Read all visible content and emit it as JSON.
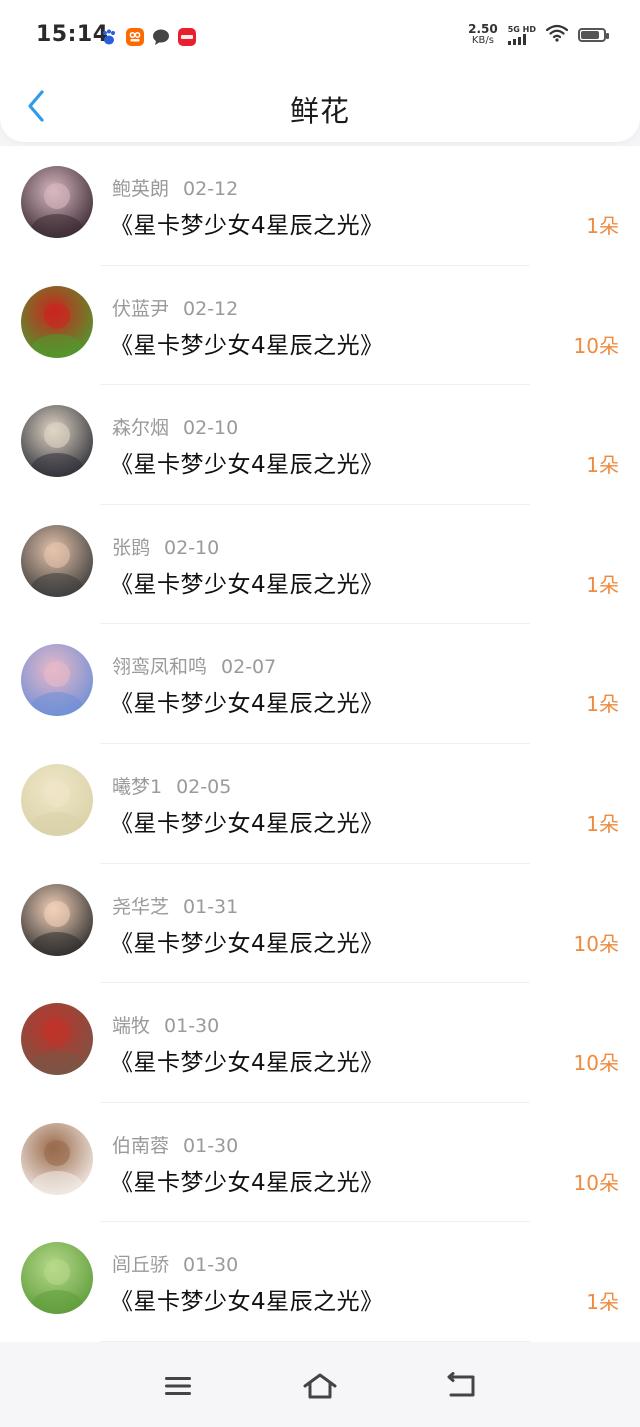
{
  "status_bar": {
    "time": "15:14",
    "net_speed": "2.50",
    "net_unit": "KB/s",
    "network": "5G HD",
    "battery_level": 0.8,
    "app_icons": [
      "baidu-paw-icon",
      "orange-app-icon",
      "chat-bubble-icon",
      "red-app-icon"
    ]
  },
  "header": {
    "title": "鲜花"
  },
  "colors": {
    "accent": "#2e9bea",
    "count": "#f08a3e",
    "meta": "#9a9a9a"
  },
  "records": [
    {
      "user": "鲍英朗",
      "date": "02-12",
      "book": "《星卡梦少女4星辰之光》",
      "count": "1朵",
      "avatar_colors": [
        "#3a2a32",
        "#d7b7c0"
      ]
    },
    {
      "user": "伏蓝尹",
      "date": "02-12",
      "book": "《星卡梦少女4星辰之光》",
      "count": "10朵",
      "avatar_colors": [
        "#4f9a2e",
        "#c9261f"
      ]
    },
    {
      "user": "森尔烟",
      "date": "02-10",
      "book": "《星卡梦少女4星辰之光》",
      "count": "1朵",
      "avatar_colors": [
        "#2f3038",
        "#e0d5c5"
      ]
    },
    {
      "user": "张鹍",
      "date": "02-10",
      "book": "《星卡梦少女4星辰之光》",
      "count": "1朵",
      "avatar_colors": [
        "#3c3c3c",
        "#e4c3ab"
      ]
    },
    {
      "user": "翎鸾凤和鸣",
      "date": "02-07",
      "book": "《星卡梦少女4星辰之光》",
      "count": "1朵",
      "avatar_colors": [
        "#6f8fd6",
        "#e8b9c8"
      ]
    },
    {
      "user": "曦梦1",
      "date": "02-05",
      "book": "《星卡梦少女4星辰之光》",
      "count": "1朵",
      "avatar_colors": [
        "#d9d2a8",
        "#f0e6c8"
      ]
    },
    {
      "user": "尧华芝",
      "date": "01-31",
      "book": "《星卡梦少女4星辰之光》",
      "count": "10朵",
      "avatar_colors": [
        "#2d2d2d",
        "#f2d0b8"
      ]
    },
    {
      "user": "端牧",
      "date": "01-30",
      "book": "《星卡梦少女4星辰之光》",
      "count": "10朵",
      "avatar_colors": [
        "#7a5546",
        "#c0332a"
      ]
    },
    {
      "user": "伯南蓉",
      "date": "01-30",
      "book": "《星卡梦少女4星辰之光》",
      "count": "10朵",
      "avatar_colors": [
        "#f3ece7",
        "#9a6b4c"
      ]
    },
    {
      "user": "闾丘骄",
      "date": "01-30",
      "book": "《星卡梦少女4星辰之光》",
      "count": "1朵",
      "avatar_colors": [
        "#5f9d3c",
        "#b6d88a"
      ]
    }
  ],
  "nav_bar": {
    "buttons": [
      "menu-icon",
      "home-icon",
      "back-icon"
    ]
  }
}
